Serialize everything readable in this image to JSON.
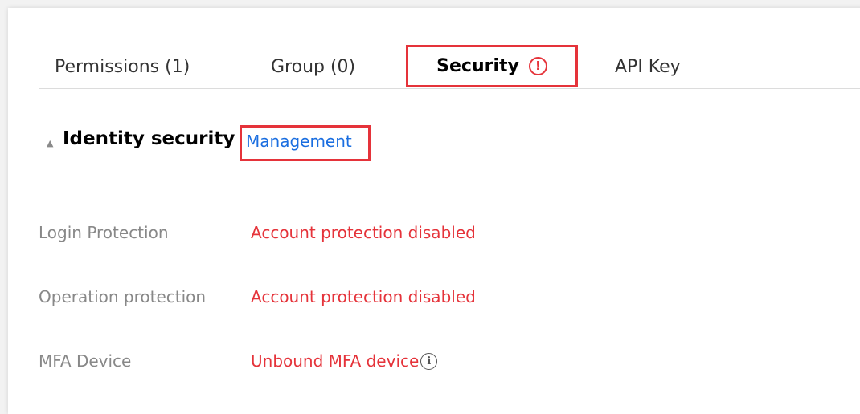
{
  "tabs": [
    {
      "label": "Permissions (1)"
    },
    {
      "label": "Group (0)"
    },
    {
      "label": "Security",
      "alert_glyph": "!"
    },
    {
      "label": "API Key"
    }
  ],
  "section": {
    "collapse_glyph": "▲",
    "title": "Identity security",
    "link_label": "Management"
  },
  "rows": [
    {
      "label": "Login Protection",
      "value": "Account protection disabled"
    },
    {
      "label": "Operation protection",
      "value": "Account protection disabled"
    },
    {
      "label": "MFA Device",
      "value": "Unbound MFA device",
      "info_glyph": "i"
    }
  ],
  "colors": {
    "highlight": "#e5333a",
    "link": "#1a6ee0",
    "label": "#888888"
  }
}
